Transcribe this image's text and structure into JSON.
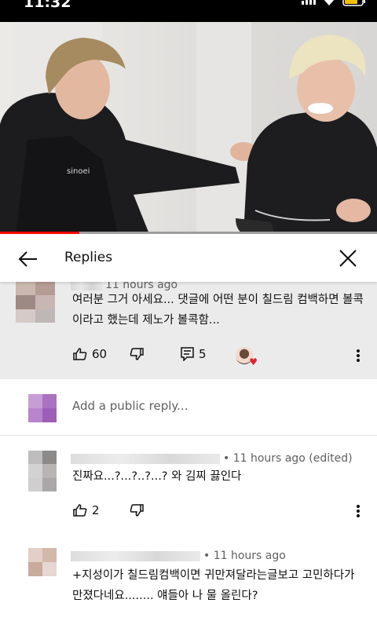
{
  "status_bar": {
    "time": "11:32"
  },
  "video": {
    "progress": 0.21
  },
  "header": {
    "title": "Replies"
  },
  "parent_comment": {
    "time": "11 hours ago",
    "text_line1": "여러분 그거 아세요... 댓글에 어떤 분이 칠드림 컴백하면 볼콕",
    "text_line2": "이라고 했는데 제노가 볼콕함...",
    "likes": "60",
    "replies": "5",
    "icons": [
      "thumbs-up-icon",
      "thumbs-down-icon",
      "reply-icon",
      "creator-heart-icon",
      "more-vert-icon"
    ]
  },
  "reply_box": {
    "placeholder": "Add a public reply..."
  },
  "replies": [
    {
      "meta": "• 11 hours ago (edited)",
      "text_lines": [
        "진짜요...?...?..?...? 와 김찌 끓인다"
      ],
      "likes": "2"
    },
    {
      "meta": "• 11 hours ago",
      "text_lines": [
        "+지성이가 칠드림컴백이면 귀만져달라는글보고 고민하다가",
        "만졌다네요........ 얘들아 나 물 올린다?"
      ]
    }
  ],
  "colors": {
    "accent_red": "#ff0000",
    "text_secondary": "#606060",
    "selected_bg": "#ebebeb"
  }
}
